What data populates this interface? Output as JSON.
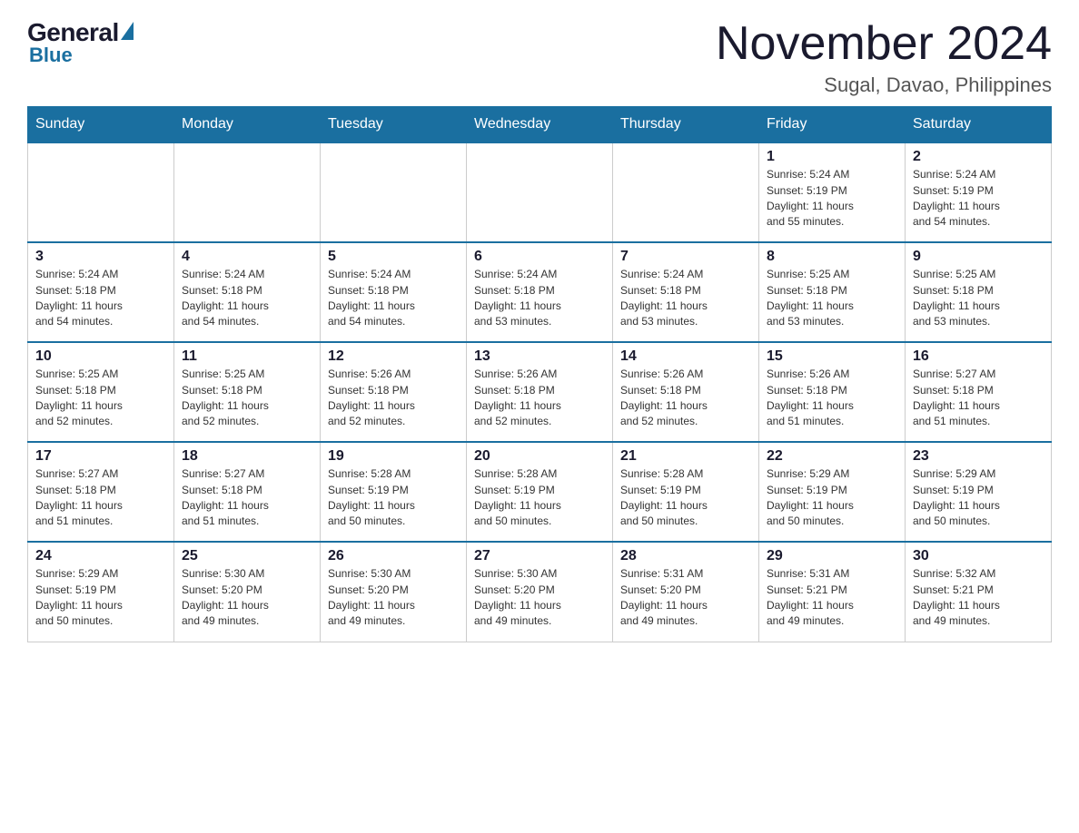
{
  "logo": {
    "general": "General",
    "blue": "Blue"
  },
  "header": {
    "month": "November 2024",
    "location": "Sugal, Davao, Philippines"
  },
  "weekdays": [
    "Sunday",
    "Monday",
    "Tuesday",
    "Wednesday",
    "Thursday",
    "Friday",
    "Saturday"
  ],
  "weeks": [
    [
      {
        "day": "",
        "info": ""
      },
      {
        "day": "",
        "info": ""
      },
      {
        "day": "",
        "info": ""
      },
      {
        "day": "",
        "info": ""
      },
      {
        "day": "",
        "info": ""
      },
      {
        "day": "1",
        "info": "Sunrise: 5:24 AM\nSunset: 5:19 PM\nDaylight: 11 hours\nand 55 minutes."
      },
      {
        "day": "2",
        "info": "Sunrise: 5:24 AM\nSunset: 5:19 PM\nDaylight: 11 hours\nand 54 minutes."
      }
    ],
    [
      {
        "day": "3",
        "info": "Sunrise: 5:24 AM\nSunset: 5:18 PM\nDaylight: 11 hours\nand 54 minutes."
      },
      {
        "day": "4",
        "info": "Sunrise: 5:24 AM\nSunset: 5:18 PM\nDaylight: 11 hours\nand 54 minutes."
      },
      {
        "day": "5",
        "info": "Sunrise: 5:24 AM\nSunset: 5:18 PM\nDaylight: 11 hours\nand 54 minutes."
      },
      {
        "day": "6",
        "info": "Sunrise: 5:24 AM\nSunset: 5:18 PM\nDaylight: 11 hours\nand 53 minutes."
      },
      {
        "day": "7",
        "info": "Sunrise: 5:24 AM\nSunset: 5:18 PM\nDaylight: 11 hours\nand 53 minutes."
      },
      {
        "day": "8",
        "info": "Sunrise: 5:25 AM\nSunset: 5:18 PM\nDaylight: 11 hours\nand 53 minutes."
      },
      {
        "day": "9",
        "info": "Sunrise: 5:25 AM\nSunset: 5:18 PM\nDaylight: 11 hours\nand 53 minutes."
      }
    ],
    [
      {
        "day": "10",
        "info": "Sunrise: 5:25 AM\nSunset: 5:18 PM\nDaylight: 11 hours\nand 52 minutes."
      },
      {
        "day": "11",
        "info": "Sunrise: 5:25 AM\nSunset: 5:18 PM\nDaylight: 11 hours\nand 52 minutes."
      },
      {
        "day": "12",
        "info": "Sunrise: 5:26 AM\nSunset: 5:18 PM\nDaylight: 11 hours\nand 52 minutes."
      },
      {
        "day": "13",
        "info": "Sunrise: 5:26 AM\nSunset: 5:18 PM\nDaylight: 11 hours\nand 52 minutes."
      },
      {
        "day": "14",
        "info": "Sunrise: 5:26 AM\nSunset: 5:18 PM\nDaylight: 11 hours\nand 52 minutes."
      },
      {
        "day": "15",
        "info": "Sunrise: 5:26 AM\nSunset: 5:18 PM\nDaylight: 11 hours\nand 51 minutes."
      },
      {
        "day": "16",
        "info": "Sunrise: 5:27 AM\nSunset: 5:18 PM\nDaylight: 11 hours\nand 51 minutes."
      }
    ],
    [
      {
        "day": "17",
        "info": "Sunrise: 5:27 AM\nSunset: 5:18 PM\nDaylight: 11 hours\nand 51 minutes."
      },
      {
        "day": "18",
        "info": "Sunrise: 5:27 AM\nSunset: 5:18 PM\nDaylight: 11 hours\nand 51 minutes."
      },
      {
        "day": "19",
        "info": "Sunrise: 5:28 AM\nSunset: 5:19 PM\nDaylight: 11 hours\nand 50 minutes."
      },
      {
        "day": "20",
        "info": "Sunrise: 5:28 AM\nSunset: 5:19 PM\nDaylight: 11 hours\nand 50 minutes."
      },
      {
        "day": "21",
        "info": "Sunrise: 5:28 AM\nSunset: 5:19 PM\nDaylight: 11 hours\nand 50 minutes."
      },
      {
        "day": "22",
        "info": "Sunrise: 5:29 AM\nSunset: 5:19 PM\nDaylight: 11 hours\nand 50 minutes."
      },
      {
        "day": "23",
        "info": "Sunrise: 5:29 AM\nSunset: 5:19 PM\nDaylight: 11 hours\nand 50 minutes."
      }
    ],
    [
      {
        "day": "24",
        "info": "Sunrise: 5:29 AM\nSunset: 5:19 PM\nDaylight: 11 hours\nand 50 minutes."
      },
      {
        "day": "25",
        "info": "Sunrise: 5:30 AM\nSunset: 5:20 PM\nDaylight: 11 hours\nand 49 minutes."
      },
      {
        "day": "26",
        "info": "Sunrise: 5:30 AM\nSunset: 5:20 PM\nDaylight: 11 hours\nand 49 minutes."
      },
      {
        "day": "27",
        "info": "Sunrise: 5:30 AM\nSunset: 5:20 PM\nDaylight: 11 hours\nand 49 minutes."
      },
      {
        "day": "28",
        "info": "Sunrise: 5:31 AM\nSunset: 5:20 PM\nDaylight: 11 hours\nand 49 minutes."
      },
      {
        "day": "29",
        "info": "Sunrise: 5:31 AM\nSunset: 5:21 PM\nDaylight: 11 hours\nand 49 minutes."
      },
      {
        "day": "30",
        "info": "Sunrise: 5:32 AM\nSunset: 5:21 PM\nDaylight: 11 hours\nand 49 minutes."
      }
    ]
  ]
}
